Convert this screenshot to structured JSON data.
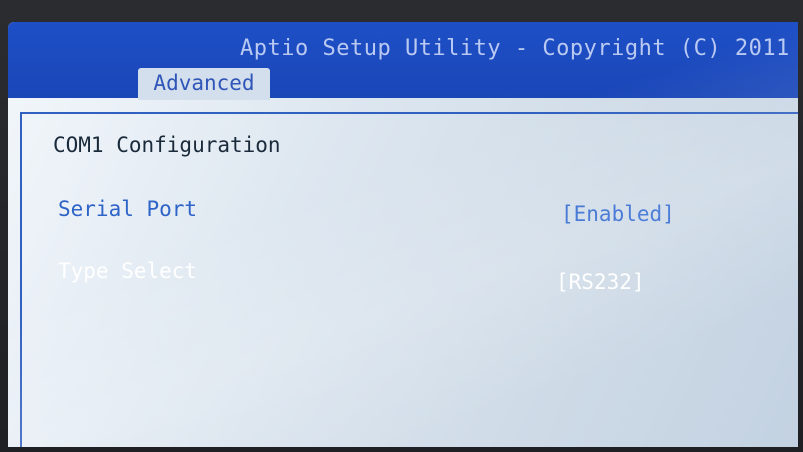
{
  "header": {
    "title": "Aptio Setup Utility - Copyright (C) 2011",
    "active_tab": "Advanced"
  },
  "page": {
    "section_title": "COM1 Configuration"
  },
  "settings": [
    {
      "label": "Serial Port",
      "value": "[Enabled]"
    },
    {
      "label": "Type Select",
      "value": "[RS232]"
    }
  ],
  "colors": {
    "title_bar": "#1e4fc6",
    "selected_label": "#2e63c8",
    "background": "#dfe8f1"
  }
}
